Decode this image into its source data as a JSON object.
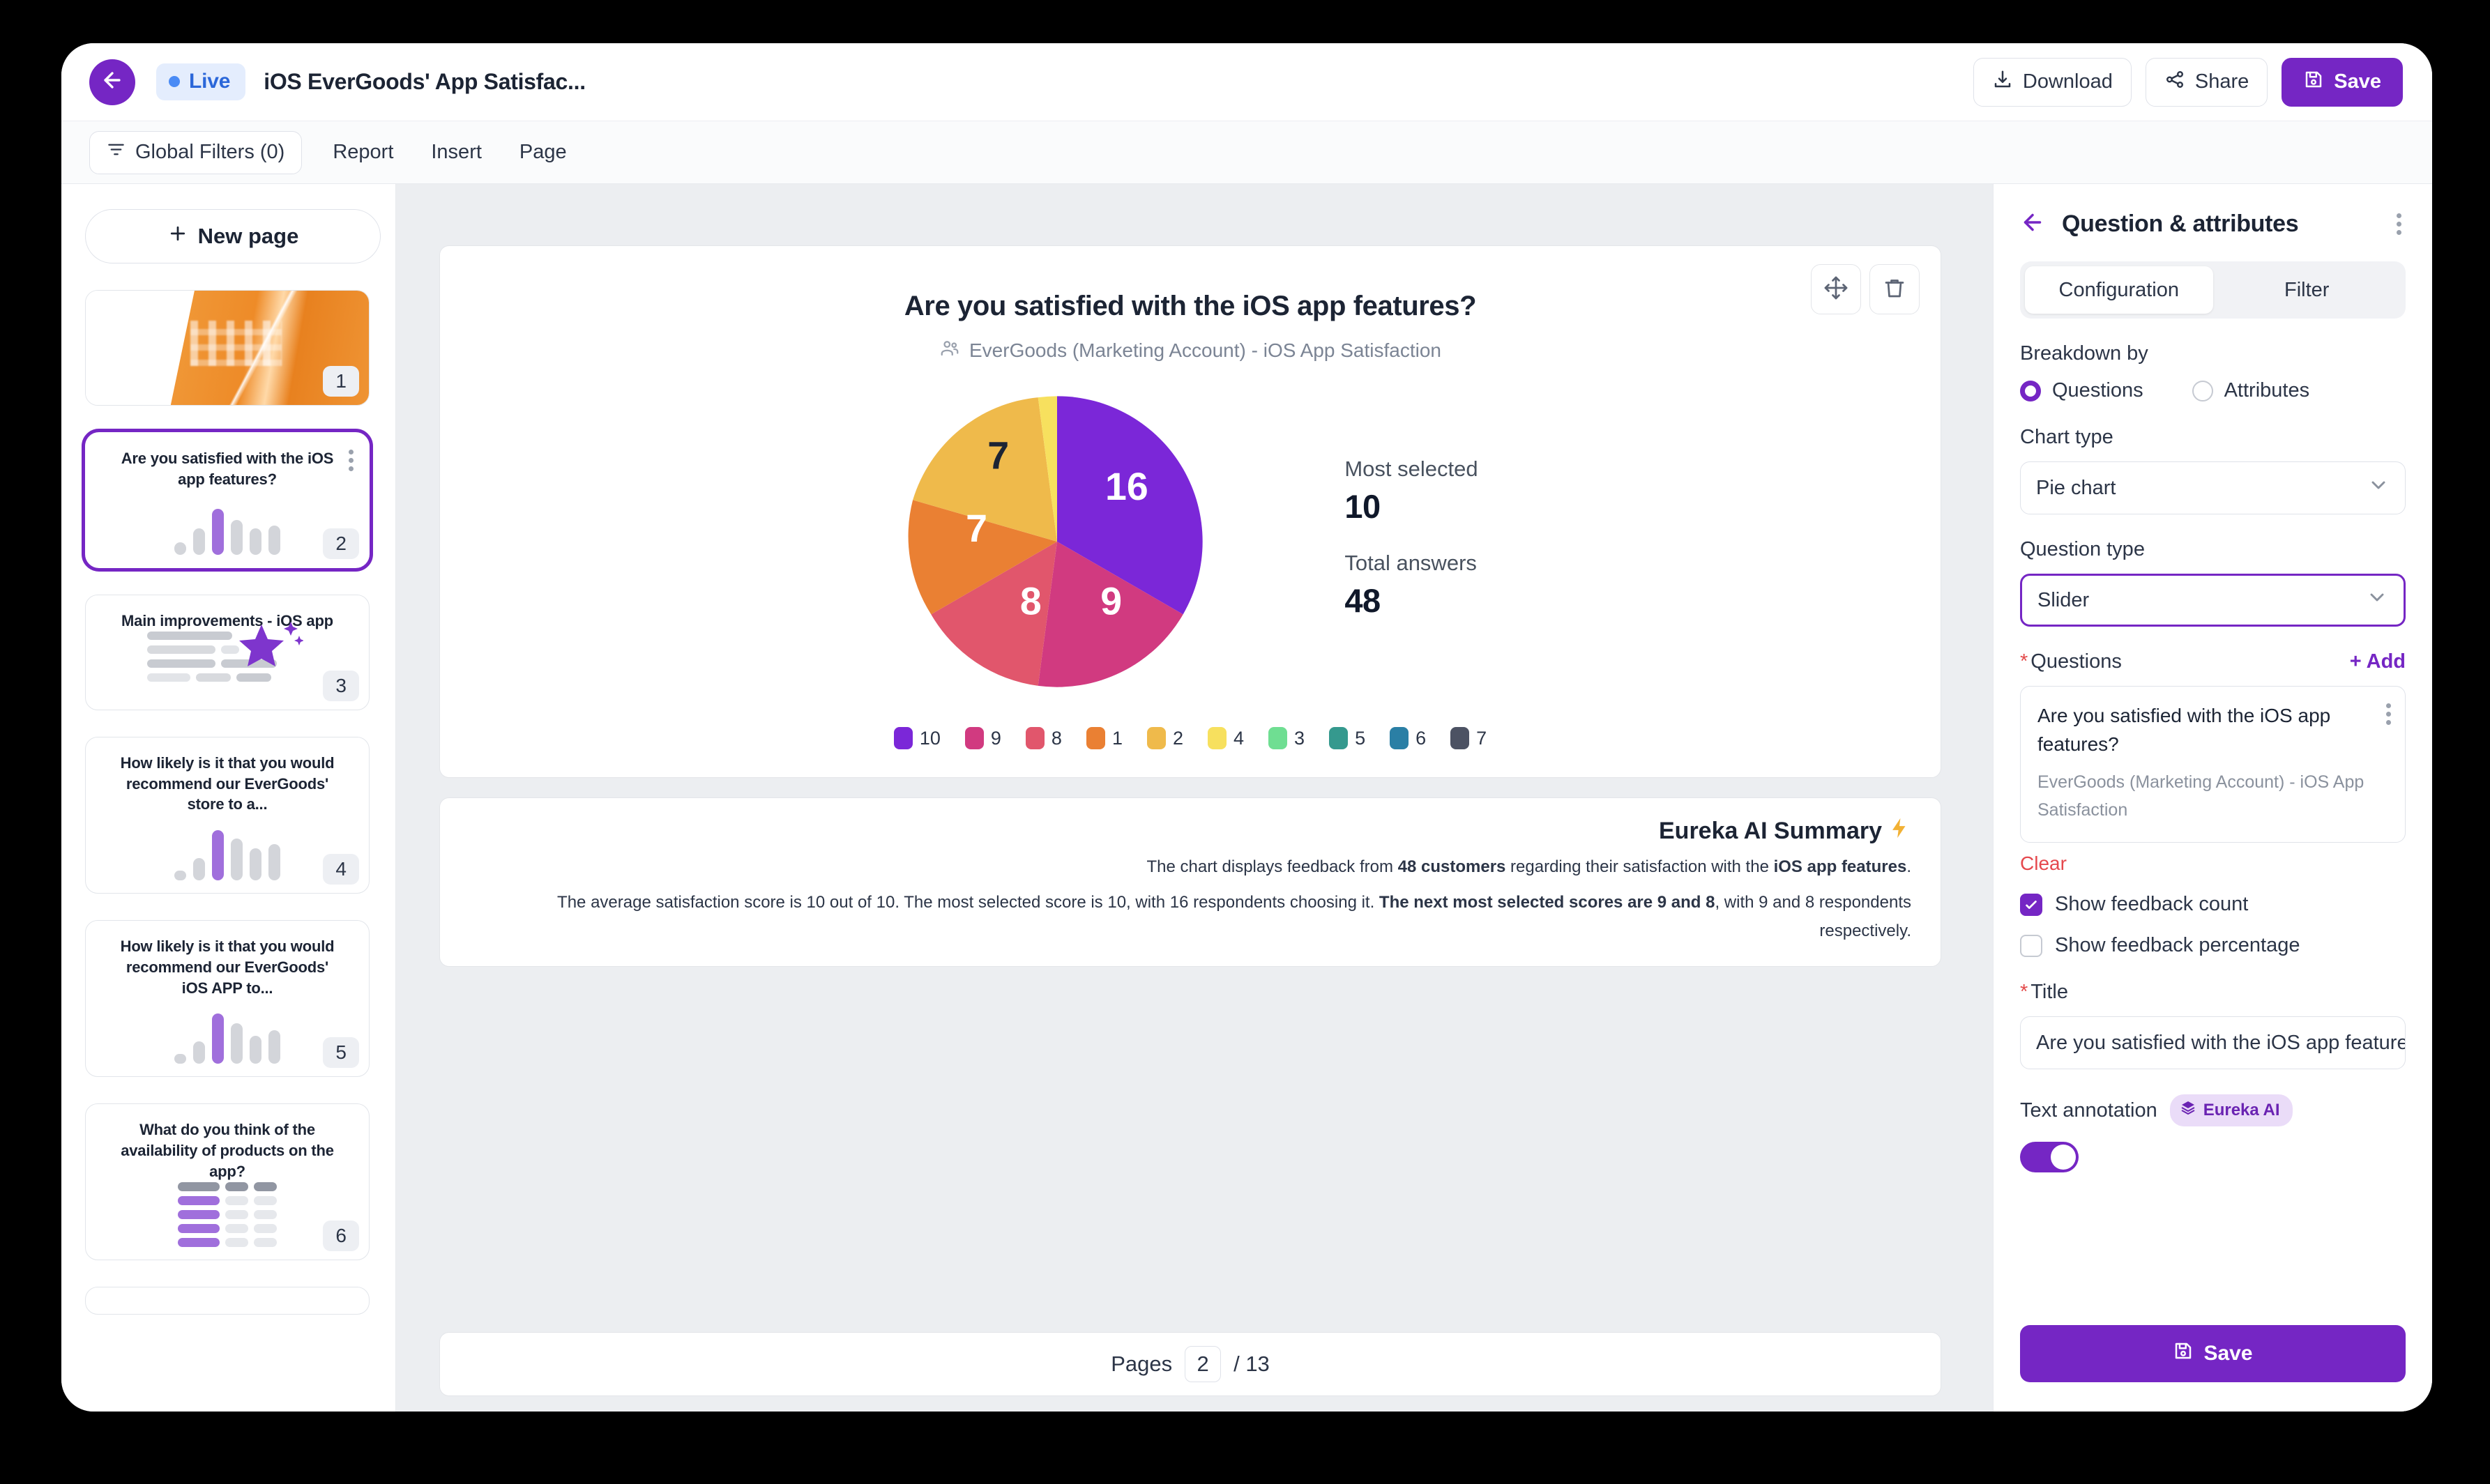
{
  "topbar": {
    "back_icon": "arrow-left-icon",
    "status_badge": "Live",
    "document_title": "iOS EverGoods' App Satisfac...",
    "download_label": "Download",
    "share_label": "Share",
    "save_label": "Save"
  },
  "menubar": {
    "global_filters_label": "Global Filters (0)",
    "items": [
      {
        "label": "Report"
      },
      {
        "label": "Insert"
      },
      {
        "label": "Page"
      }
    ]
  },
  "sidebar": {
    "new_page_label": "New page",
    "pages": [
      {
        "number": "1",
        "title": "",
        "kind": "image"
      },
      {
        "number": "2",
        "title": "Are you satisfied with the iOS app features?",
        "kind": "bars",
        "selected": true
      },
      {
        "number": "3",
        "title": "Main improvements - iOS app",
        "kind": "star"
      },
      {
        "number": "4",
        "title": "How likely is it that you would recommend our EverGoods' store to a...",
        "kind": "bars"
      },
      {
        "number": "5",
        "title": "How likely is it that you would recommend our EverGoods' iOS APP to...",
        "kind": "bars"
      },
      {
        "number": "6",
        "title": "What do you think of the availability of products on the app?",
        "kind": "grid"
      }
    ]
  },
  "canvas": {
    "move_icon": "move-icon",
    "delete_icon": "trash-icon",
    "stats": {
      "most_selected_label": "Most selected",
      "most_selected_value": "10",
      "total_answers_label": "Total answers",
      "total_answers_value": "48"
    },
    "summary": {
      "heading": "Eureka AI Summary",
      "bolt_icon": "lightning-icon",
      "line1_a": "The chart displays feedback from ",
      "line1_b": "48 customers",
      "line1_c": " regarding their satisfaction with the ",
      "line1_d": "iOS app features",
      "line1_e": ".",
      "line2_a": "The average satisfaction score is 10 out of 10. The most selected score is 10, with 16 respondents choosing it. ",
      "line2_b": "The next most selected scores are 9 and 8",
      "line2_c": ", with 9 and 8 respondents respectively."
    },
    "pages_bar": {
      "label": "Pages",
      "current": "2",
      "separator": "/ 13"
    }
  },
  "chart_data": {
    "type": "pie",
    "title": "Are you satisfied with the iOS app features?",
    "subtitle": "EverGoods (Marketing Account) - iOS App Satisfaction",
    "subtitle_icon": "audience-icon",
    "categories": [
      "10",
      "9",
      "8",
      "1",
      "2",
      "4",
      "3",
      "5",
      "6",
      "7"
    ],
    "values": [
      16,
      9,
      8,
      7,
      7,
      1,
      0,
      0,
      0,
      0
    ],
    "colors": [
      "#7b27d8",
      "#d13a80",
      "#e1566c",
      "#ea8033",
      "#efba4b",
      "#f7e05e",
      "#6fde92",
      "#35998e",
      "#2a7fa5",
      "#4c5263"
    ],
    "labels_shown": [
      "16",
      "9",
      "8",
      "7",
      "7"
    ],
    "legend_position": "bottom",
    "total": 48,
    "most_selected": 10
  },
  "right_panel": {
    "back_icon": "arrow-left-icon",
    "title": "Question & attributes",
    "kebab_icon": "more-vertical-icon",
    "tabs": [
      {
        "label": "Configuration",
        "active": true
      },
      {
        "label": "Filter",
        "active": false
      }
    ],
    "breakdown_label": "Breakdown by",
    "breakdown_options": [
      {
        "label": "Questions",
        "selected": true
      },
      {
        "label": "Attributes",
        "selected": false
      }
    ],
    "chart_type_label": "Chart type",
    "chart_type_value": "Pie chart",
    "question_type_label": "Question type",
    "question_type_value": "Slider",
    "questions_label": "Questions",
    "questions_required": "*",
    "add_label": "+ Add",
    "question_card": {
      "title": "Are you satisfied with the iOS app features?",
      "subtitle": "EverGoods (Marketing Account) - iOS App Satisfaction",
      "kebab_icon": "more-vertical-icon"
    },
    "clear_label": "Clear",
    "checkboxes": [
      {
        "label": "Show feedback count",
        "checked": true
      },
      {
        "label": "Show feedback percentage",
        "checked": false
      }
    ],
    "title_label": "Title",
    "title_required": "*",
    "title_value": "Are you satisfied with the iOS app features",
    "text_annotation_label": "Text annotation",
    "ai_pill_label": "Eureka AI",
    "ai_pill_icon": "layers-icon",
    "text_annotation_on": true,
    "save_label": "Save",
    "save_icon": "floppy-disk-icon"
  }
}
